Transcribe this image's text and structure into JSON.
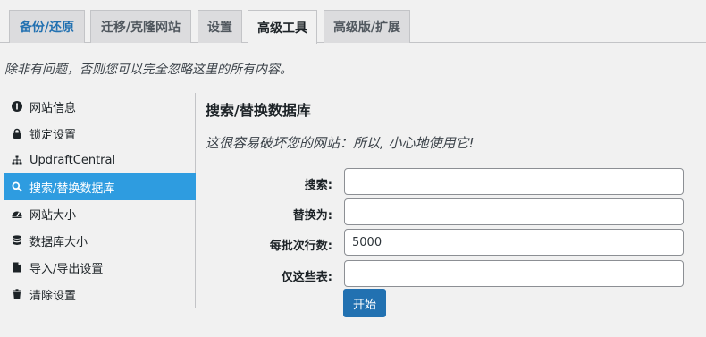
{
  "tabs": [
    {
      "label": "备份/还原"
    },
    {
      "label": "迁移/克隆网站"
    },
    {
      "label": "设置"
    },
    {
      "label": "高级工具"
    },
    {
      "label": "高级版/扩展"
    }
  ],
  "intro_text": "除非有问题，否则您可以完全忽略这里的所有内容。",
  "sidebar": {
    "items": [
      {
        "label": "网站信息",
        "icon": "info-icon"
      },
      {
        "label": "锁定设置",
        "icon": "lock-icon"
      },
      {
        "label": "UpdraftCentral",
        "icon": "sitemap-icon"
      },
      {
        "label": "搜索/替换数据库",
        "icon": "search-icon"
      },
      {
        "label": "网站大小",
        "icon": "dashboard-icon"
      },
      {
        "label": "数据库大小",
        "icon": "database-icon"
      },
      {
        "label": "导入/导出设置",
        "icon": "file-icon"
      },
      {
        "label": "清除设置",
        "icon": "trash-icon"
      }
    ]
  },
  "main": {
    "title": "搜索/替换数据库",
    "warning": "这很容易破坏您的网站：所以, 小心地使用它!",
    "fields": [
      {
        "label": "搜索:",
        "value": ""
      },
      {
        "label": "替换为:",
        "value": ""
      },
      {
        "label": "每批次行数:",
        "value": "5000"
      },
      {
        "label": "仅这些表:",
        "value": ""
      }
    ],
    "start_button": "开始"
  },
  "colors": {
    "accent": "#2271b1",
    "sidebar_active": "#2e9ce0",
    "background": "#f1f1f1"
  }
}
